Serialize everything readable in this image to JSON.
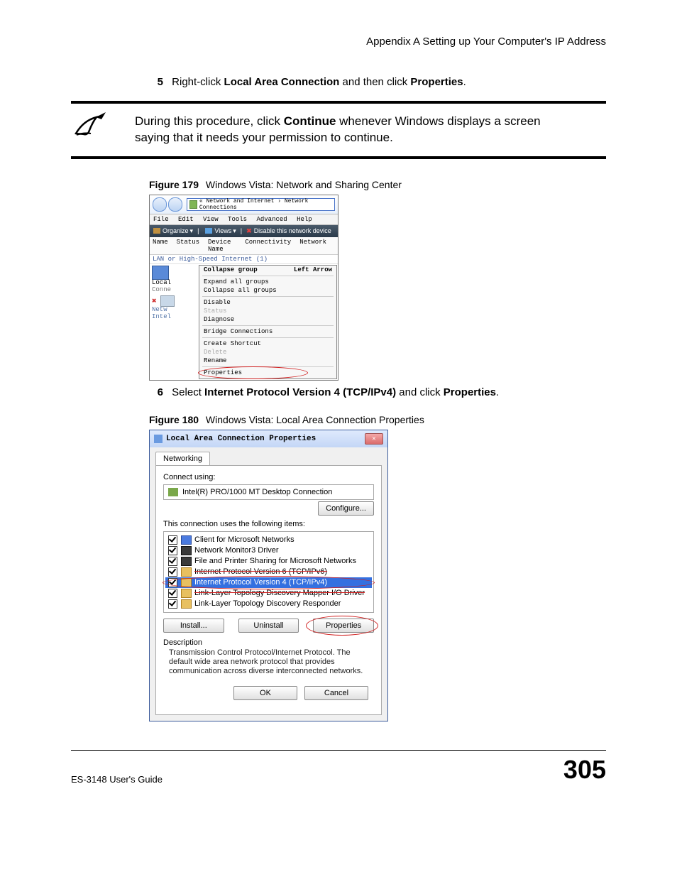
{
  "header": "Appendix A Setting up Your Computer's IP Address",
  "step5": {
    "num": "5",
    "pre": "Right-click ",
    "b1": "Local Area Connection",
    "mid": " and then click ",
    "b2": "Properties",
    "post": "."
  },
  "note": {
    "l1_pre": "During this procedure, click ",
    "l1_b": "Continue",
    "l1_post": " whenever Windows displays a screen",
    "l2": "saying that it needs your permission to continue."
  },
  "fig179": {
    "label": "Figure 179",
    "caption": "Windows Vista: Network and Sharing Center"
  },
  "ss1": {
    "address": "« Network and Internet  ›  Network Connections",
    "menu": [
      "File",
      "Edit",
      "View",
      "Tools",
      "Advanced",
      "Help"
    ],
    "toolbar": {
      "organize": "Organize",
      "views": "Views",
      "disable": "Disable this network device"
    },
    "columns": [
      "Name",
      "Status",
      "Device Name",
      "Connectivity",
      "Network"
    ],
    "category": "LAN or High-Speed Internet (1)",
    "left": {
      "l1": "Local",
      "l2": "Conne",
      "l3": "Netw",
      "l4": "Intel"
    },
    "ctx": {
      "collapse_group": "Collapse group",
      "hint": "Left Arrow",
      "expand_all": "Expand all groups",
      "collapse_all": "Collapse all groups",
      "disable": "Disable",
      "status": "Status",
      "diagnose": "Diagnose",
      "bridge": "Bridge Connections",
      "shortcut": "Create Shortcut",
      "delete": "Delete",
      "rename": "Rename",
      "properties": "Properties"
    }
  },
  "step6": {
    "num": "6",
    "pre": "Select ",
    "b1": "Internet Protocol Version 4 (TCP/IPv4)",
    "mid": " and click ",
    "b2": "Properties",
    "post": "."
  },
  "fig180": {
    "label": "Figure 180",
    "caption": "Windows Vista: Local Area Connection Properties"
  },
  "ss2": {
    "title": "Local Area Connection Properties",
    "tab": "Networking",
    "connect_using": "Connect using:",
    "adapter": "Intel(R) PRO/1000 MT Desktop Connection",
    "configure": "Configure...",
    "uses": "This connection uses the following items:",
    "items": [
      "Client for Microsoft Networks",
      "Network Monitor3 Driver",
      "File and Printer Sharing for Microsoft Networks",
      "Internet Protocol Version 6 (TCP/IPv6)",
      "Internet Protocol Version 4 (TCP/IPv4)",
      "Link-Layer Topology Discovery Mapper I/O Driver",
      "Link-Layer Topology Discovery Responder"
    ],
    "install": "Install...",
    "uninstall": "Uninstall",
    "properties": "Properties",
    "desc_label": "Description",
    "desc": "Transmission Control Protocol/Internet Protocol. The default wide area network protocol that provides communication across diverse interconnected networks.",
    "ok": "OK",
    "cancel": "Cancel"
  },
  "footer": {
    "guide": "ES-3148 User's Guide",
    "page": "305"
  }
}
